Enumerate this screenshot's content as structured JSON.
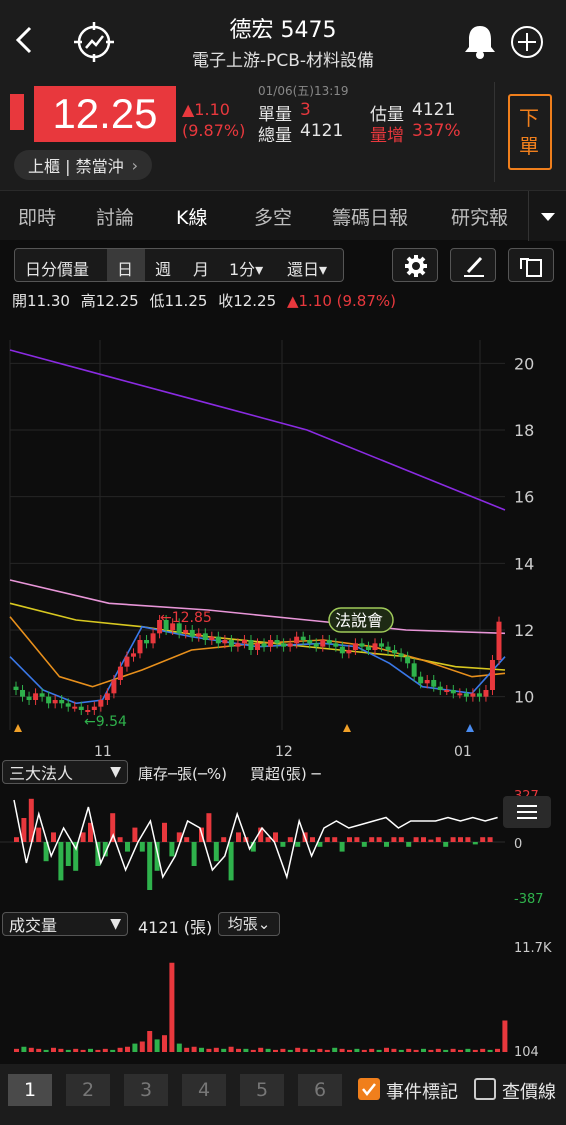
{
  "header": {
    "stock_name": "德宏 5475",
    "sector": "電子上游-PCB-材料設備"
  },
  "quote": {
    "datetime": "01/06(五)13:19",
    "price": "12.25",
    "change": "▲1.10",
    "change_pct": "(9.87%)",
    "unit_vol_label": "單量",
    "unit_vol": "3",
    "total_vol_label": "總量",
    "total_vol": "4121",
    "est_vol_label": "估量",
    "est_vol": "4121",
    "vol_incr_label": "量增",
    "vol_incr": "337%",
    "order_button": "下單",
    "market_tag": "上櫃 | 禁當沖"
  },
  "tabs": [
    {
      "label": "即時"
    },
    {
      "label": "討論"
    },
    {
      "label": "K線"
    },
    {
      "label": "多空"
    },
    {
      "label": "籌碼日報"
    },
    {
      "label": "研究報"
    }
  ],
  "toolbar": {
    "segments": [
      "日分價量",
      "日",
      "週",
      "月",
      "1分▾",
      "還日▾"
    ]
  },
  "ohlc": {
    "open": "開11.30",
    "high": "高12.25",
    "low": "低11.25",
    "close": "收12.25",
    "change": "▲1.10 (9.87%)"
  },
  "chart_labels": {
    "high_marker": "←12.85",
    "low_marker": "←9.54",
    "event_badge": "法說會",
    "x_ticks": [
      "11",
      "12",
      "01"
    ]
  },
  "chart_data": {
    "type": "line",
    "y_ticks": [
      "20",
      "18",
      "16",
      "14",
      "12",
      "10"
    ],
    "ylim": [
      9.3,
      20.7
    ],
    "series": [
      {
        "color": "#8a2be2",
        "values": [
          [
            0,
            20.4
          ],
          [
            30,
            19.6
          ],
          [
            60,
            18.8
          ],
          [
            90,
            18.0
          ],
          [
            120,
            16.8
          ],
          [
            150,
            15.6
          ]
        ]
      },
      {
        "color": "#e896d8",
        "values": [
          [
            0,
            13.5
          ],
          [
            30,
            12.8
          ],
          [
            60,
            12.6
          ],
          [
            90,
            12.3
          ],
          [
            120,
            12.0
          ],
          [
            150,
            11.9
          ]
        ]
      },
      {
        "color": "#d8c820",
        "values": [
          [
            0,
            12.8
          ],
          [
            20,
            12.3
          ],
          [
            40,
            12.1
          ],
          [
            60,
            11.8
          ],
          [
            80,
            11.6
          ],
          [
            100,
            11.4
          ],
          [
            120,
            11.2
          ],
          [
            135,
            10.9
          ],
          [
            150,
            10.8
          ]
        ]
      },
      {
        "color": "#e8901c",
        "values": [
          [
            0,
            12.4
          ],
          [
            15,
            10.6
          ],
          [
            25,
            10.3
          ],
          [
            40,
            10.8
          ],
          [
            55,
            11.4
          ],
          [
            75,
            11.6
          ],
          [
            95,
            11.7
          ],
          [
            110,
            11.5
          ],
          [
            125,
            11.1
          ],
          [
            140,
            10.6
          ],
          [
            150,
            10.7
          ]
        ]
      },
      {
        "color": "#3a78e8",
        "values": [
          [
            0,
            11.2
          ],
          [
            10,
            10.2
          ],
          [
            20,
            9.8
          ],
          [
            28,
            9.9
          ],
          [
            40,
            12.1
          ],
          [
            55,
            11.8
          ],
          [
            75,
            11.5
          ],
          [
            95,
            11.6
          ],
          [
            105,
            11.5
          ],
          [
            115,
            11.0
          ],
          [
            125,
            10.3
          ],
          [
            140,
            10.1
          ],
          [
            150,
            11.2
          ]
        ]
      }
    ]
  },
  "institutional": {
    "dropdown": "三大法人",
    "legend_inventory": "庫存─張(─%)",
    "legend_buy": "買超(張) ─",
    "top_tick": "327",
    "zero_tick": "0",
    "bottom_tick": "-387"
  },
  "volume": {
    "dropdown": "成交量",
    "value": "4121 (張)",
    "avg_label": "均張⌄",
    "top_tick": "11.7K",
    "bottom_tick": "104"
  },
  "bottom_bar": {
    "pages": [
      "1",
      "2",
      "3",
      "4",
      "5",
      "6"
    ],
    "event_mark": "事件標記",
    "price_line": "查價線"
  },
  "colors": {
    "up": "#e8383d",
    "down": "#2fb24c",
    "accent": "#f07f1c"
  }
}
